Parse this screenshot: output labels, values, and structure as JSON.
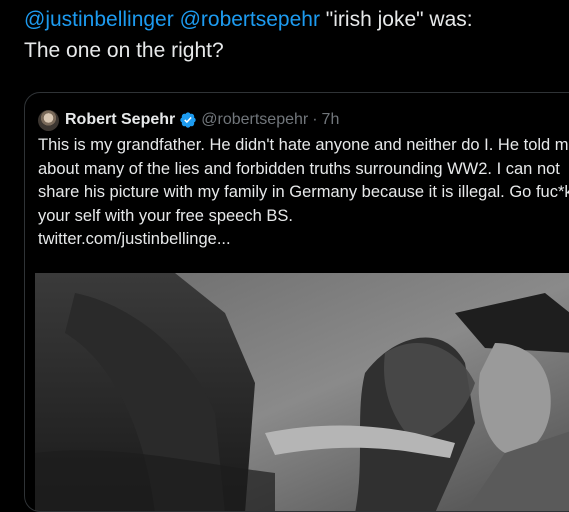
{
  "reply": {
    "mention_1": "@justinbellinger",
    "mention_2": "@robertsepehr",
    "line_1_rest": " \"irish joke\" was:",
    "line_2": "The one on the right?"
  },
  "quote": {
    "author_name": "Robert Sepehr",
    "handle": "@robertsepehr",
    "separator": "·",
    "time": "7h",
    "text": "This is my grandfather. He didn't hate anyone and neither do I. He told me about many of the lies and forbidden truths surrounding WW2. I can not share his picture with my family in Germany because it is illegal. Go fuc*k your self with your free speech BS.",
    "link": "twitter.com/justinbellinge..."
  },
  "icons": {
    "verified": "verified-badge-icon",
    "avatar": "avatar"
  },
  "colors": {
    "background": "#000000",
    "text": "#e7e9ea",
    "muted": "#71767b",
    "accent": "#1d9bf0",
    "border": "#2f3336"
  }
}
